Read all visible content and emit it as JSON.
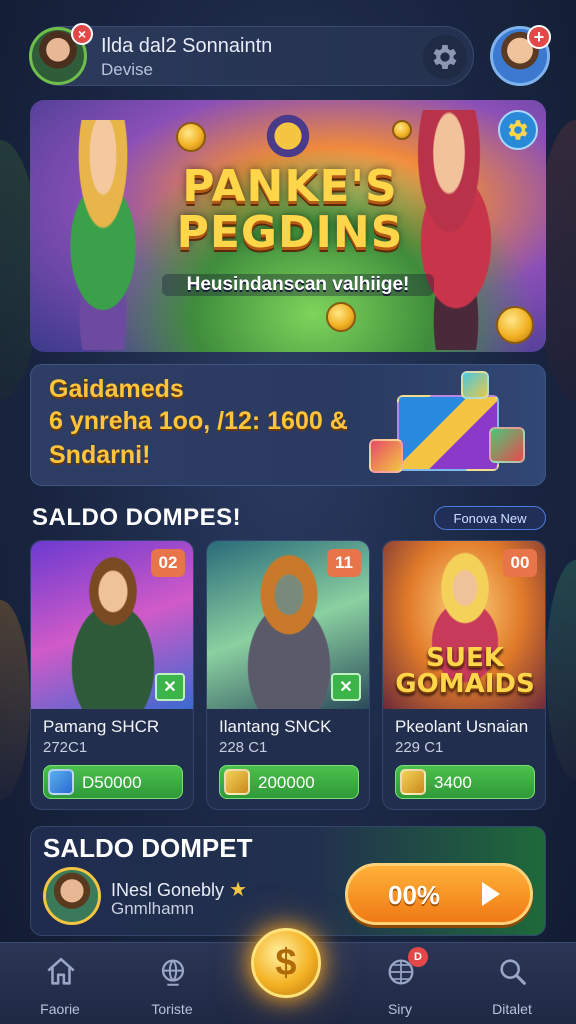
{
  "header": {
    "user_name": "Ilda dal2 Sonnaintn",
    "user_sub": "Devise",
    "close_badge": "×",
    "profile_badge": "+"
  },
  "hero": {
    "title_line1": "PANKE'S",
    "title_line2": "PEGDINS",
    "subtitle": "Heusindanscan valhiige!"
  },
  "promo": {
    "line1": "Gaidameds",
    "line2": "6 ynreha  1oo, /12: 1600 &",
    "line3": "Sndarni!"
  },
  "section": {
    "title": "SALDO DOMPES!",
    "button_label": "Fonova New"
  },
  "games": [
    {
      "number": "02",
      "title": "Pamang SHCR",
      "sub": "272C1",
      "value": "D50000",
      "has_check": true,
      "art_text": ""
    },
    {
      "number": "11",
      "title": "Ilantang SNCK",
      "sub": "228 C1",
      "value": "200000",
      "has_check": true,
      "art_text": ""
    },
    {
      "number": "00",
      "title": "Pkeolant Usnaian",
      "sub": "229 C1",
      "value": "3400",
      "has_check": false,
      "art_text": "SUEK GOMAIDS"
    }
  ],
  "wallet": {
    "title": "SALDO DOMPET",
    "name": "INesl Gonebly",
    "sub": "Gnmlhamn",
    "button_label": "00%"
  },
  "nav": {
    "items": [
      {
        "label": "Faorie",
        "icon": "home-icon"
      },
      {
        "label": "Toriste",
        "icon": "globe-icon"
      },
      {
        "label": "",
        "icon": "coin-icon"
      },
      {
        "label": "Siry",
        "icon": "network-icon",
        "badge": "D"
      },
      {
        "label": "Ditalet",
        "icon": "search-icon"
      }
    ],
    "center_symbol": "$"
  },
  "colors": {
    "background": "#1a2642",
    "accent_gold": "#ffc53a",
    "accent_green": "#3bb54a",
    "accent_orange": "#f07a14",
    "badge_red": "#e24848"
  }
}
